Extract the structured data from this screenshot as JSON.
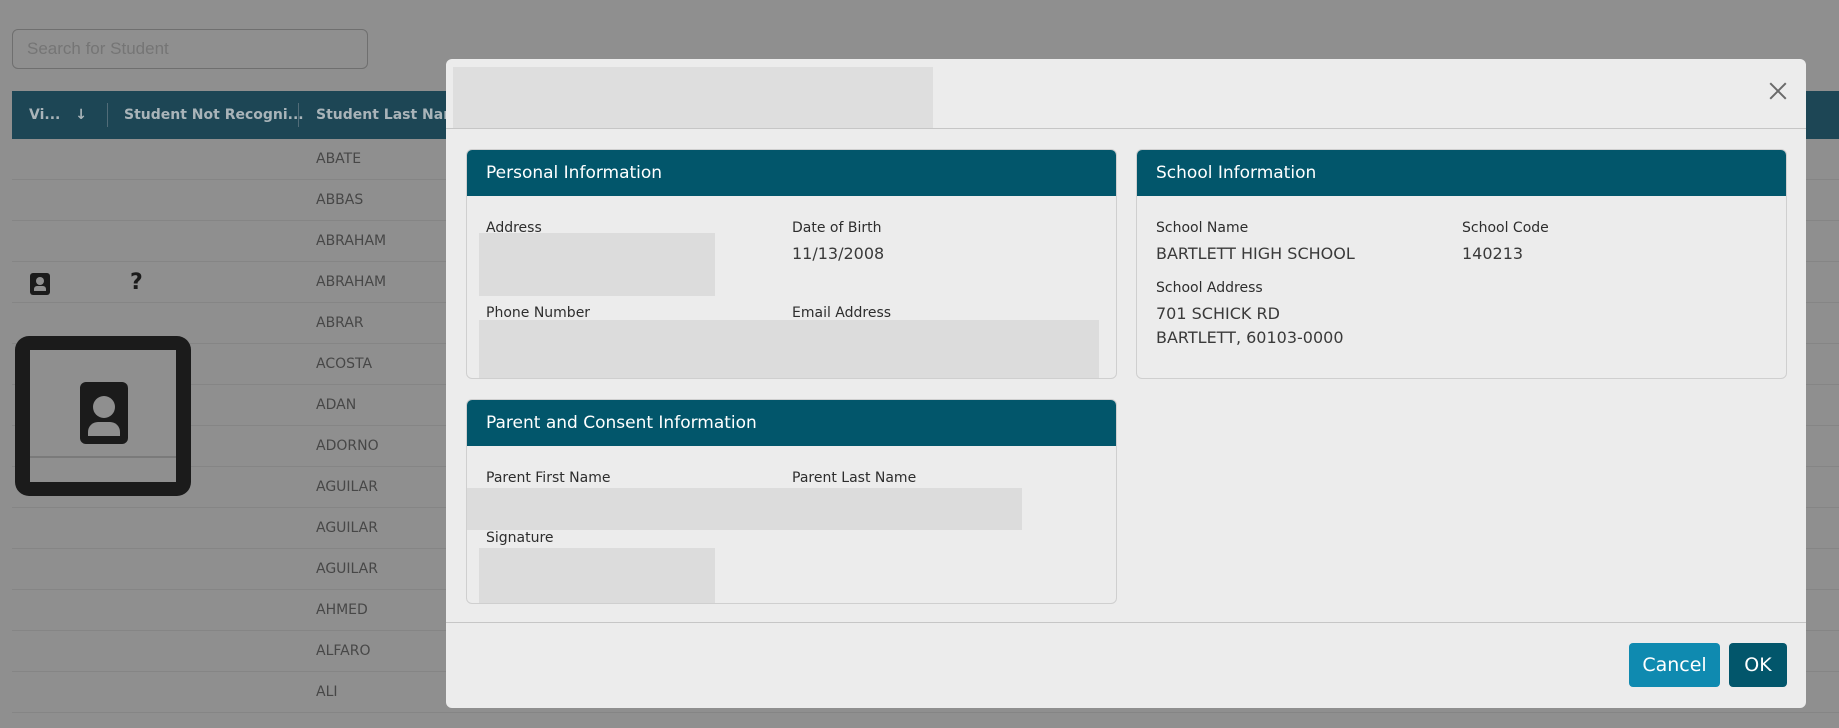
{
  "search": {
    "placeholder": "Search for Student"
  },
  "grid": {
    "columns": [
      "Vi...",
      "Student Not Recogni...",
      "Student Last Name"
    ],
    "sort_indicator": "↓",
    "rows": [
      "ABATE",
      "ABBAS",
      "ABRAHAM",
      "ABRAHAM",
      "ABRAR",
      "ACOSTA",
      "ADAN",
      "ADORNO",
      "AGUILAR",
      "AGUILAR",
      "AGUILAR",
      "AHMED",
      "ALFARO",
      "ALI"
    ],
    "flagged_row_symbol": "?"
  },
  "modal": {
    "personal": {
      "header": "Personal Information",
      "address_label": "Address",
      "dob_label": "Date of Birth",
      "dob_value": "11/13/2008",
      "phone_label": "Phone Number",
      "email_label": "Email Address"
    },
    "school": {
      "header": "School Information",
      "name_label": "School Name",
      "name_value": "BARTLETT HIGH SCHOOL",
      "code_label": "School Code",
      "code_value": "140213",
      "address_label": "School Address",
      "address_line1": "701 SCHICK RD",
      "address_line2": "BARTLETT, 60103-0000"
    },
    "parent": {
      "header": "Parent and Consent Information",
      "first_label": "Parent First Name",
      "last_label": "Parent Last Name",
      "signature_label": "Signature"
    },
    "cancel_label": "Cancel",
    "ok_label": "OK"
  },
  "colors": {
    "header_teal": "#02566b",
    "cancel_blue": "#0f8ab0",
    "overlay_gray": "#8f8f8f"
  }
}
